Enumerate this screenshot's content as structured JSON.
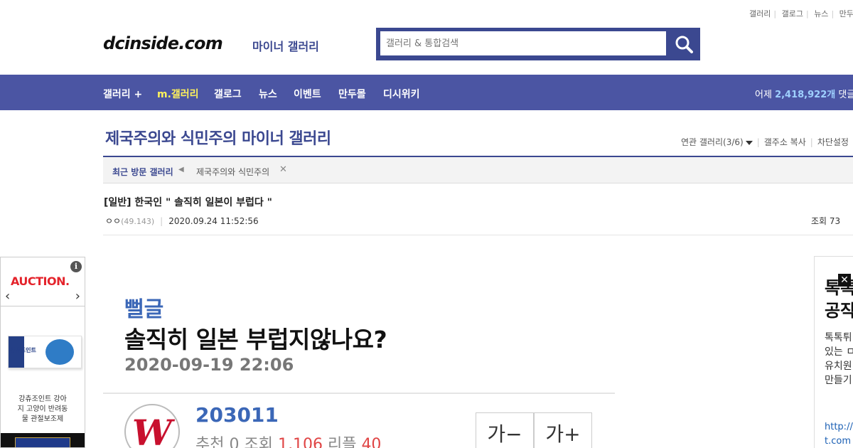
{
  "top_links": [
    "갤러리",
    "갤로그",
    "뉴스",
    "만두몰"
  ],
  "logo": {
    "text": "dcinside.com",
    "sub": "마이너 갤러리"
  },
  "search": {
    "placeholder": "갤러리 & 통합검색"
  },
  "nav": {
    "items": [
      "갤러리 +",
      "m.갤러리",
      "갤로그",
      "뉴스",
      "이벤트",
      "만두몰",
      "디시위키"
    ],
    "stats_prefix": "어제",
    "stats_count": "2,418,922개",
    "stats_suffix": "댓글"
  },
  "gallery": {
    "title": "제국주의와 식민주의 마이너 갤러리",
    "links": [
      "연관 갤러리(3/6)",
      "갤주소 복사",
      "차단설정"
    ]
  },
  "recent": {
    "label": "최근 방문 갤러리",
    "items": [
      "제국주의와 식민주의"
    ]
  },
  "post": {
    "title": "[일반] 한국인 \" 솔직히 일본이 부럽다 \"",
    "author": "ㅇㅇ",
    "ip": "(49.143)",
    "date": "2020.09.24 11:52:56",
    "views": "조회 73"
  },
  "ad_left": {
    "brand": "AUCTION.",
    "info": "i",
    "arrow_left": "‹",
    "arrow_right": "›",
    "product_label": "강츄조인트",
    "lines": [
      "강츄조인트 강아",
      "지 고양이 반려동",
      "물 관절보조제"
    ]
  },
  "card": {
    "author": "뻘글",
    "title": "솔직히 일본 부럽지않나요?",
    "date": "2020-09-19 22:06",
    "id": "203011",
    "rec_label": "추천",
    "rec": "0",
    "views_label": "조회",
    "views": "1,106",
    "reply_label": "리플",
    "replies": "40",
    "font_minus": "가−",
    "font_plus": "가+"
  },
  "ad_right": {
    "heading1": "톡톡",
    "heading2": "공작",
    "close": "✕",
    "body": [
      "톡톡튀",
      "있는 ㅁ",
      "유치원",
      "만들기"
    ],
    "link": [
      "http://",
      "t.com"
    ]
  },
  "colors": {
    "brand_blue": "#3b4890",
    "nav_bg": "#4b55a3",
    "active_yellow": "#fff35c",
    "stat_red": "#e04545"
  }
}
